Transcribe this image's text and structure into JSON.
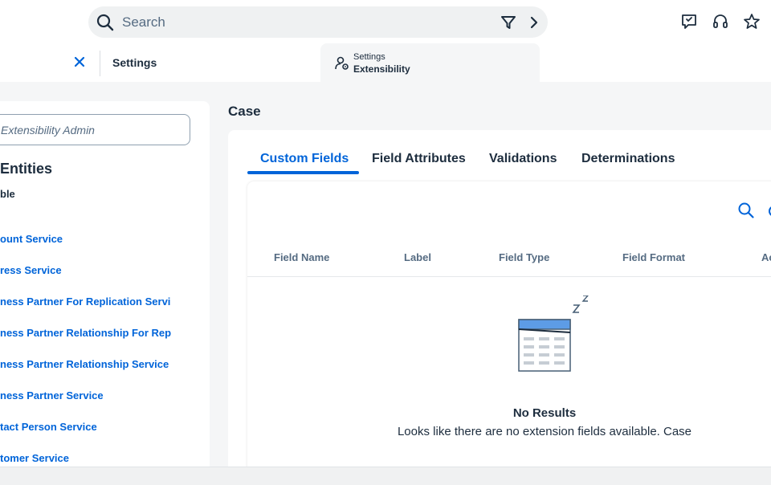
{
  "header": {
    "search_placeholder": "Search",
    "icons": [
      "search-icon",
      "filter-icon",
      "chevron-right-icon",
      "feedback-icon",
      "headset-icon",
      "star-icon"
    ]
  },
  "tabstrip": {
    "settings_label": "Settings",
    "active_tab": {
      "line1": "Settings",
      "line2": "Extensibility"
    }
  },
  "sidebar": {
    "input_value": "Extensibility Admin",
    "heading": "Entities",
    "subheading": "ble",
    "items": [
      "ount Service",
      "ress Service",
      "ness Partner For Replication Servi",
      "ness Partner Relationship For Rep",
      "ness Partner Relationship Service",
      "ness Partner Service",
      "tact Person Service",
      "tomer Service"
    ]
  },
  "main": {
    "title": "Case",
    "tabs": [
      "Custom Fields",
      "Field Attributes",
      "Validations",
      "Determinations"
    ],
    "active_tab_index": 0,
    "columns": [
      "Field Name",
      "Label",
      "Field Type",
      "Field Format",
      "Ac"
    ],
    "empty_title": "No Results",
    "empty_message": "Looks like there are no extension fields available. Case"
  },
  "colors": {
    "accent": "#0064d9",
    "text": "#1d2d3e",
    "muted": "#556b82",
    "background": "#f5f6f7"
  }
}
